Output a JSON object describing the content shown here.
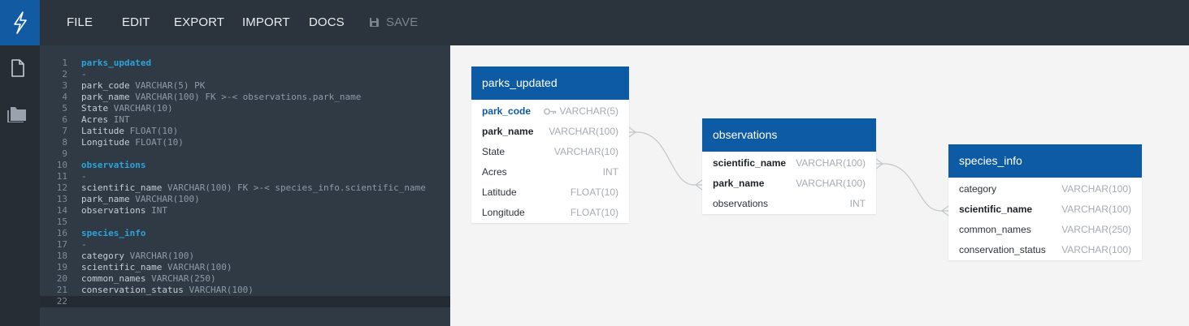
{
  "menu": {
    "file": "FILE",
    "edit": "EDIT",
    "export": "EXPORT",
    "import": "IMPORT",
    "docs": "DOCS",
    "save": "SAVE"
  },
  "icons": {
    "logo": "lightning-bolt-icon",
    "document": "document-icon",
    "folder": "folder-icon",
    "save": "floppy-disk-icon",
    "key": "key-icon"
  },
  "colors": {
    "brand": "#125aa2",
    "table_header": "#0c5ba4",
    "editor_background": "#2f3a45",
    "canvas_background": "#f3f4f3"
  },
  "editor": {
    "lines": [
      {
        "num": "1",
        "parts": [
          {
            "t": "parks_updated",
            "c": "tbl"
          }
        ]
      },
      {
        "num": "2",
        "parts": [
          {
            "t": "-",
            "c": "dash"
          }
        ]
      },
      {
        "num": "3",
        "parts": [
          {
            "t": "park_code "
          },
          {
            "t": "VARCHAR(5) PK",
            "c": "typ"
          }
        ]
      },
      {
        "num": "4",
        "parts": [
          {
            "t": "park_name "
          },
          {
            "t": "VARCHAR(100) FK >-< observations.park_name",
            "c": "typ"
          }
        ]
      },
      {
        "num": "5",
        "parts": [
          {
            "t": "State "
          },
          {
            "t": "VARCHAR(10)",
            "c": "typ"
          }
        ]
      },
      {
        "num": "6",
        "parts": [
          {
            "t": "Acres "
          },
          {
            "t": "INT",
            "c": "typ"
          }
        ]
      },
      {
        "num": "7",
        "parts": [
          {
            "t": "Latitude "
          },
          {
            "t": "FLOAT(10)",
            "c": "typ"
          }
        ]
      },
      {
        "num": "8",
        "parts": [
          {
            "t": "Longitude "
          },
          {
            "t": "FLOAT(10)",
            "c": "typ"
          }
        ]
      },
      {
        "num": "9",
        "parts": []
      },
      {
        "num": "10",
        "parts": [
          {
            "t": "observations",
            "c": "tbl"
          }
        ]
      },
      {
        "num": "11",
        "parts": [
          {
            "t": "-",
            "c": "dash"
          }
        ]
      },
      {
        "num": "12",
        "parts": [
          {
            "t": "scientific_name "
          },
          {
            "t": "VARCHAR(100) FK >-< species_info.scientific_name",
            "c": "typ"
          }
        ]
      },
      {
        "num": "13",
        "parts": [
          {
            "t": "park_name "
          },
          {
            "t": "VARCHAR(100)",
            "c": "typ"
          }
        ]
      },
      {
        "num": "14",
        "parts": [
          {
            "t": "observations "
          },
          {
            "t": "INT",
            "c": "typ"
          }
        ]
      },
      {
        "num": "15",
        "parts": []
      },
      {
        "num": "16",
        "parts": [
          {
            "t": "species_info",
            "c": "tbl"
          }
        ]
      },
      {
        "num": "17",
        "parts": [
          {
            "t": "-",
            "c": "dash"
          }
        ]
      },
      {
        "num": "18",
        "parts": [
          {
            "t": "category "
          },
          {
            "t": "VARCHAR(100)",
            "c": "typ"
          }
        ]
      },
      {
        "num": "19",
        "parts": [
          {
            "t": "scientific_name "
          },
          {
            "t": "VARCHAR(100)",
            "c": "typ"
          }
        ]
      },
      {
        "num": "20",
        "parts": [
          {
            "t": "common_names "
          },
          {
            "t": "VARCHAR(250)",
            "c": "typ"
          }
        ]
      },
      {
        "num": "21",
        "parts": [
          {
            "t": "conservation_status "
          },
          {
            "t": "VARCHAR(100)",
            "c": "typ"
          }
        ]
      },
      {
        "num": "22",
        "parts": []
      }
    ],
    "active_line": "22"
  },
  "diagram": {
    "tables": [
      {
        "id": "parks_updated",
        "title": "parks_updated",
        "columns": [
          {
            "name": "park_code",
            "type": "VARCHAR(5)",
            "style": "pk",
            "key": true
          },
          {
            "name": "park_name",
            "type": "VARCHAR(100)",
            "style": "bold"
          },
          {
            "name": "State",
            "type": "VARCHAR(10)",
            "style": ""
          },
          {
            "name": "Acres",
            "type": "INT",
            "style": ""
          },
          {
            "name": "Latitude",
            "type": "FLOAT(10)",
            "style": ""
          },
          {
            "name": "Longitude",
            "type": "FLOAT(10)",
            "style": ""
          }
        ]
      },
      {
        "id": "observations",
        "title": "observations",
        "columns": [
          {
            "name": "scientific_name",
            "type": "VARCHAR(100)",
            "style": "bold"
          },
          {
            "name": "park_name",
            "type": "VARCHAR(100)",
            "style": "bold"
          },
          {
            "name": "observations",
            "type": "INT",
            "style": ""
          }
        ]
      },
      {
        "id": "species_info",
        "title": "species_info",
        "columns": [
          {
            "name": "category",
            "type": "VARCHAR(100)",
            "style": ""
          },
          {
            "name": "scientific_name",
            "type": "VARCHAR(100)",
            "style": "bold"
          },
          {
            "name": "common_names",
            "type": "VARCHAR(250)",
            "style": ""
          },
          {
            "name": "conservation_status",
            "type": "VARCHAR(100)",
            "style": ""
          }
        ]
      }
    ]
  }
}
